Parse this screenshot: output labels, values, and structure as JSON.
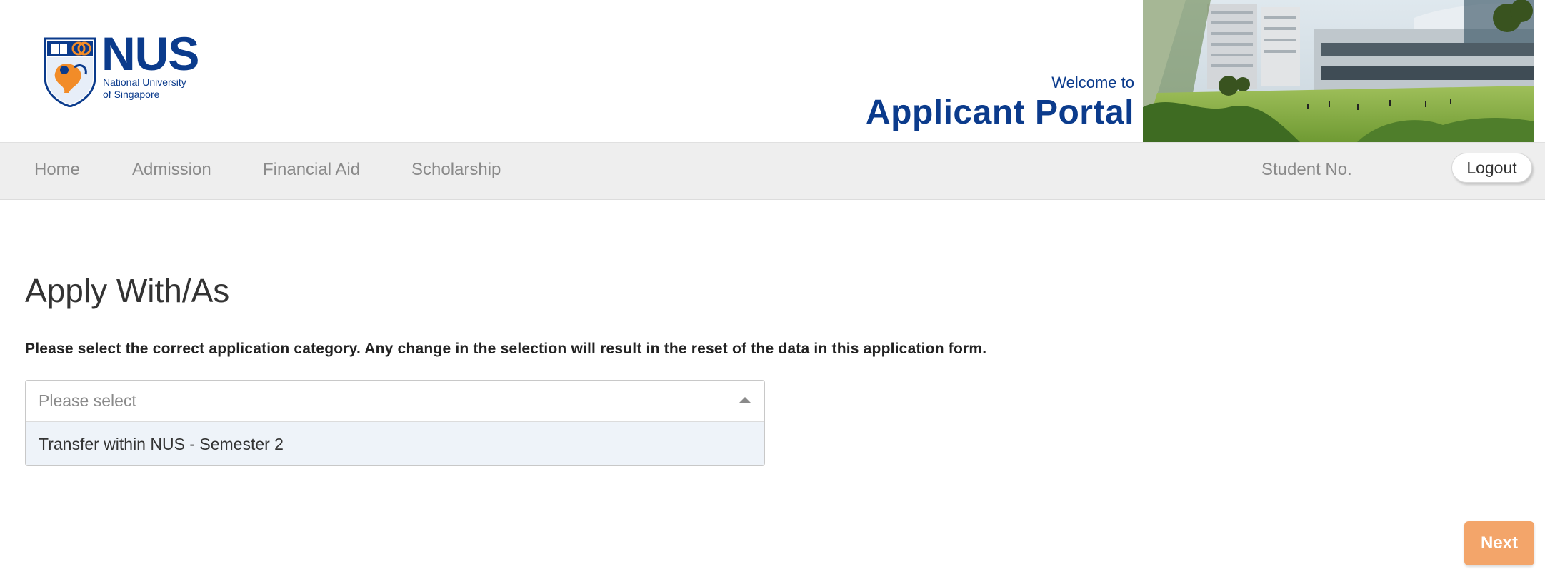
{
  "header": {
    "logo": {
      "wordmark": "NUS",
      "subtitle_line1": "National University",
      "subtitle_line2": "of Singapore",
      "crest_icon": "nus-crest-icon"
    },
    "welcome_text": "Welcome to",
    "portal_title": "Applicant Portal"
  },
  "nav": {
    "items": [
      {
        "label": "Home"
      },
      {
        "label": "Admission"
      },
      {
        "label": "Financial Aid"
      },
      {
        "label": "Scholarship"
      }
    ],
    "student_no_label": "Student No.",
    "logout_label": "Logout"
  },
  "main": {
    "title": "Apply With/As",
    "instruction": "Please select the correct application category. Any change in the selection will result in the reset of the data in this application form.",
    "select": {
      "placeholder": "Please select",
      "options": [
        {
          "label": "Transfer within NUS - Semester 2"
        }
      ]
    },
    "next_label": "Next"
  },
  "colors": {
    "brand_blue": "#0b3b8c",
    "brand_orange": "#f28c28",
    "next_button": "#f3a56a",
    "navbar_bg": "#eeeeee",
    "option_highlight": "#eef3f9"
  }
}
